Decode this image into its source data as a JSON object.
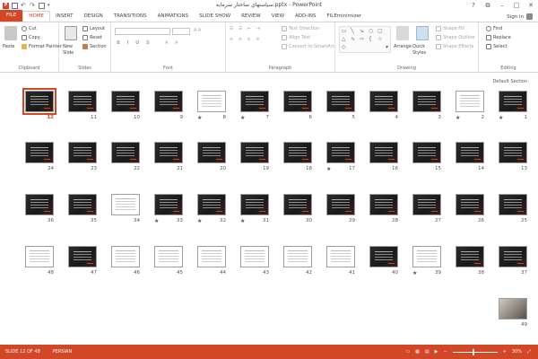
{
  "window": {
    "title": "سياستهاي ساختار سرمايه.pptx - PowerPoint",
    "controls": [
      "?",
      "⧉",
      "–",
      "□",
      "✕"
    ]
  },
  "tabs": [
    "FILE",
    "HOME",
    "INSERT",
    "DESIGN",
    "TRANSITIONS",
    "ANIMATIONS",
    "SLIDE SHOW",
    "REVIEW",
    "VIEW",
    "ADD-INS",
    "FILEminimizer"
  ],
  "sign_in": "Sign in",
  "ribbon": {
    "clipboard": {
      "label": "Clipboard",
      "paste": "Paste",
      "cut": "Cut",
      "copy": "Copy",
      "format_painter": "Format Painter"
    },
    "slides": {
      "label": "Slides",
      "new_slide": "New Slide",
      "layout": "Layout",
      "reset": "Reset",
      "section": "Section"
    },
    "font": {
      "label": "Font"
    },
    "paragraph": {
      "label": "Paragraph",
      "text_direction": "Text Direction",
      "align_text": "Align Text",
      "convert_smartart": "Convert to SmartArt"
    },
    "drawing": {
      "label": "Drawing",
      "arrange": "Arrange",
      "quick_styles": "Quick Styles",
      "shape_fill": "Shape Fill",
      "shape_outline": "Shape Outline",
      "shape_effects": "Shape Effects"
    },
    "editing": {
      "label": "Editing",
      "find": "Find",
      "replace": "Replace",
      "select": "Select"
    }
  },
  "section_label": "Default Section",
  "slides": [
    {
      "n": "1",
      "star": true,
      "style": "dark"
    },
    {
      "n": "2",
      "star": true,
      "style": "white"
    },
    {
      "n": "3",
      "star": false,
      "style": "dark"
    },
    {
      "n": "4",
      "star": false,
      "style": "dark"
    },
    {
      "n": "5",
      "star": false,
      "style": "dark"
    },
    {
      "n": "6",
      "star": false,
      "style": "dark"
    },
    {
      "n": "7",
      "star": true,
      "style": "dark"
    },
    {
      "n": "8",
      "star": true,
      "style": "white"
    },
    {
      "n": "9",
      "star": false,
      "style": "dark"
    },
    {
      "n": "10",
      "star": false,
      "style": "dark"
    },
    {
      "n": "11",
      "star": false,
      "style": "dark"
    },
    {
      "n": "12",
      "star": false,
      "style": "dark",
      "selected": true
    },
    {
      "n": "13",
      "star": false,
      "style": "dark"
    },
    {
      "n": "14",
      "star": false,
      "style": "dark"
    },
    {
      "n": "15",
      "star": false,
      "style": "dark"
    },
    {
      "n": "16",
      "star": false,
      "style": "dark"
    },
    {
      "n": "17",
      "star": true,
      "style": "dark"
    },
    {
      "n": "18",
      "star": false,
      "style": "dark"
    },
    {
      "n": "19",
      "star": false,
      "style": "dark"
    },
    {
      "n": "20",
      "star": false,
      "style": "dark"
    },
    {
      "n": "21",
      "star": false,
      "style": "dark"
    },
    {
      "n": "22",
      "star": false,
      "style": "dark"
    },
    {
      "n": "23",
      "star": false,
      "style": "dark"
    },
    {
      "n": "24",
      "star": false,
      "style": "dark"
    },
    {
      "n": "25",
      "star": false,
      "style": "dark"
    },
    {
      "n": "26",
      "star": false,
      "style": "dark"
    },
    {
      "n": "27",
      "star": false,
      "style": "dark"
    },
    {
      "n": "28",
      "star": false,
      "style": "dark"
    },
    {
      "n": "29",
      "star": false,
      "style": "dark"
    },
    {
      "n": "30",
      "star": false,
      "style": "dark"
    },
    {
      "n": "31",
      "star": true,
      "style": "dark"
    },
    {
      "n": "32",
      "star": true,
      "style": "dark"
    },
    {
      "n": "33",
      "star": true,
      "style": "dark"
    },
    {
      "n": "34",
      "star": false,
      "style": "white"
    },
    {
      "n": "35",
      "star": false,
      "style": "dark"
    },
    {
      "n": "36",
      "star": false,
      "style": "dark"
    },
    {
      "n": "37",
      "star": false,
      "style": "dark"
    },
    {
      "n": "38",
      "star": false,
      "style": "dark"
    },
    {
      "n": "39",
      "star": true,
      "style": "white"
    },
    {
      "n": "40",
      "star": false,
      "style": "dark"
    },
    {
      "n": "41",
      "star": false,
      "style": "white"
    },
    {
      "n": "42",
      "star": false,
      "style": "white"
    },
    {
      "n": "43",
      "star": false,
      "style": "white"
    },
    {
      "n": "44",
      "star": false,
      "style": "white"
    },
    {
      "n": "45",
      "star": false,
      "style": "white"
    },
    {
      "n": "46",
      "star": false,
      "style": "white"
    },
    {
      "n": "47",
      "star": false,
      "style": "dark"
    },
    {
      "n": "48",
      "star": false,
      "style": "white"
    },
    {
      "n": "49",
      "star": false,
      "style": "photo"
    }
  ],
  "status": {
    "slide_info": "SLIDE 12 OF 48",
    "language": "PERSIAN",
    "zoom": "30%"
  }
}
